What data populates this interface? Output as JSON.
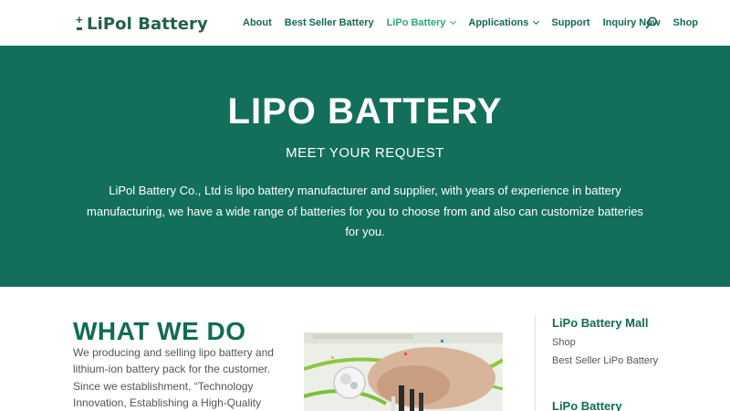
{
  "header": {
    "logo_text": "LiPol Battery",
    "nav": [
      {
        "label": "About"
      },
      {
        "label": "Best Seller Battery"
      },
      {
        "label": "LiPo Battery"
      },
      {
        "label": "Applications"
      },
      {
        "label": "Support"
      },
      {
        "label": "Inquiry Now"
      },
      {
        "label": "Shop"
      }
    ],
    "active_nav": "LiPo Battery"
  },
  "hero": {
    "title": "LIPO BATTERY",
    "subtitle": "MEET YOUR REQUEST",
    "body": "LiPol Battery Co., Ltd is lipo battery manufacturer and supplier, with years of experience in battery manufacturing, we have a wide range of batteries for you to choose from and also can customize batteries for you."
  },
  "what_we_do": {
    "title": "WHAT WE DO",
    "body": "We producing and selling lipo battery and lithium-ion battery pack for the customer. Since we establishment, “Technology Innovation, Establishing a High-Quality"
  },
  "sidebar": {
    "mall_heading": "LiPo Battery Mall",
    "links": [
      "Shop",
      "Best Seller LiPo Battery"
    ],
    "battery_heading": "LiPo Battery"
  },
  "colors": {
    "brand": "#136f5b",
    "nav_text": "#116b56",
    "nav_active": "#2ea67e"
  }
}
